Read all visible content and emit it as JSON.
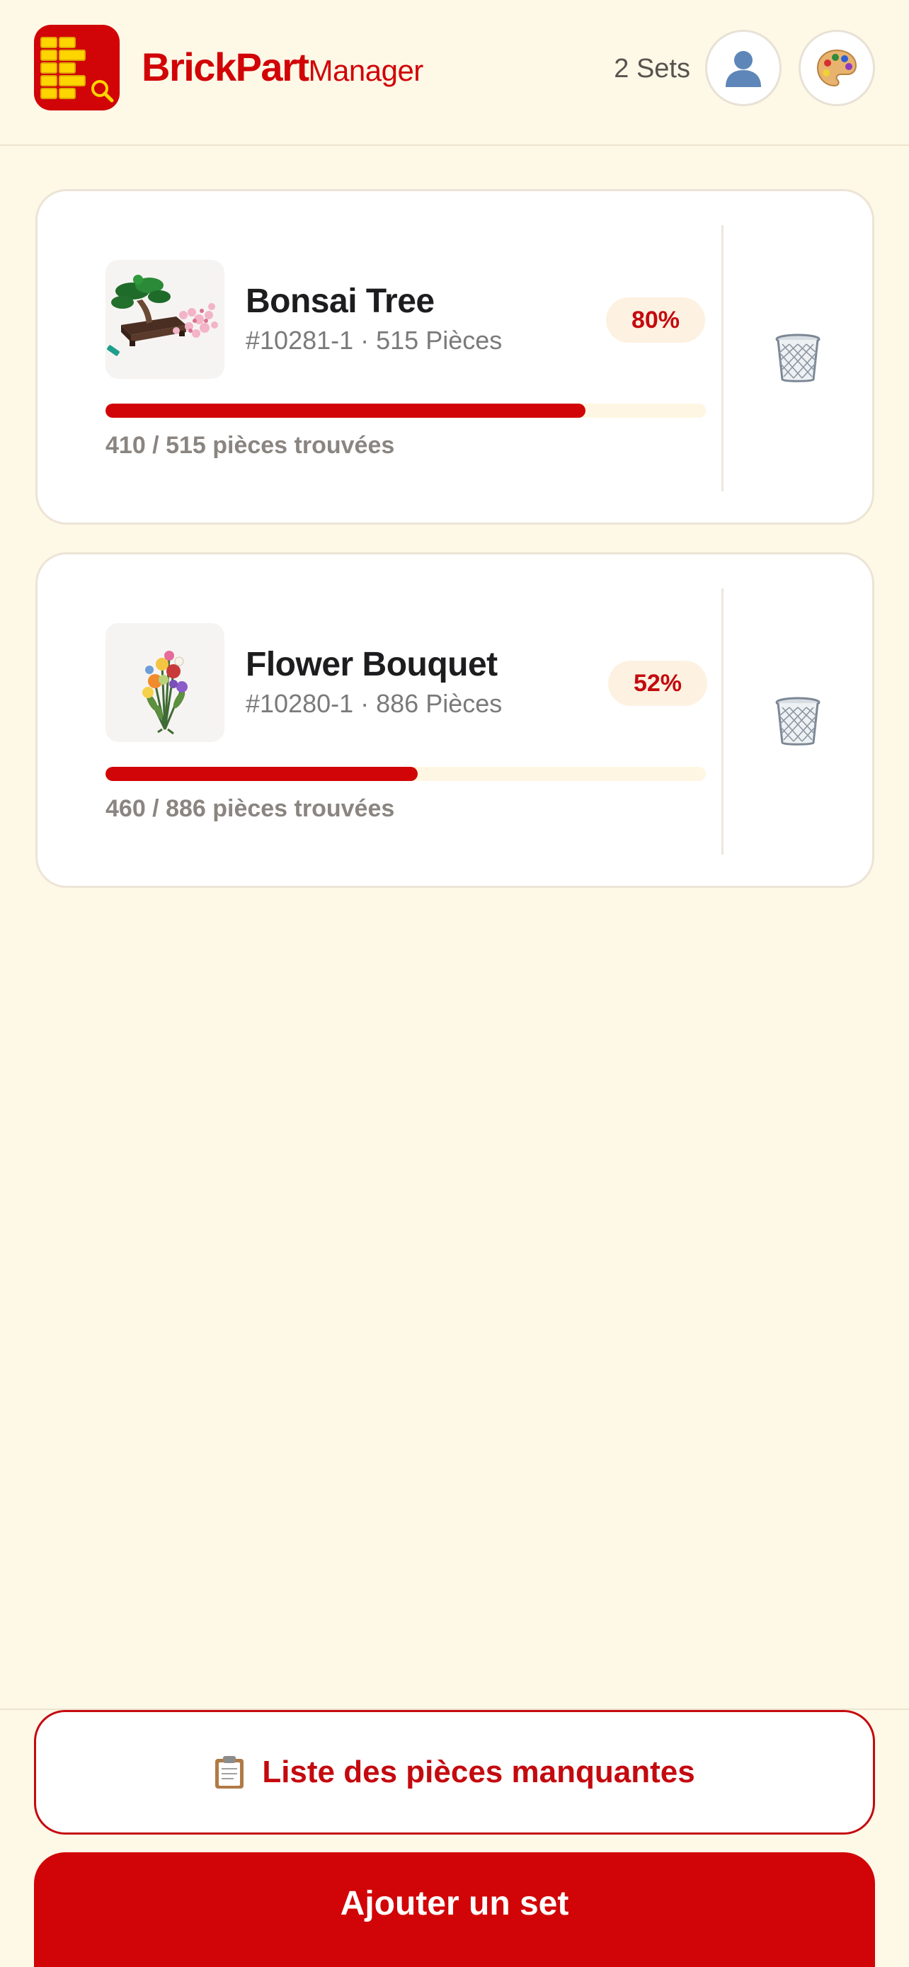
{
  "header": {
    "brand_main": "BrickPart",
    "brand_sub": "Manager",
    "sets_count": "2 Sets",
    "logo_icon": "brick-search-logo",
    "profile_icon": "user-silhouette-icon",
    "theme_icon": "palette-icon"
  },
  "sets": [
    {
      "name": "Bonsai Tree",
      "meta": "#10281-1 · 515 Pièces",
      "percent_label": "80%",
      "progress": 0.8,
      "found_text": "410 / 515 pièces trouvées",
      "thumbnail_icon": "bonsai-tree-image",
      "delete_icon": "trash-bin-icon"
    },
    {
      "name": "Flower Bouquet",
      "meta": "#10280-1 · 886 Pièces",
      "percent_label": "52%",
      "progress": 0.52,
      "found_text": "460 / 886 pièces trouvées",
      "thumbnail_icon": "flower-bouquet-image",
      "delete_icon": "trash-bin-icon"
    }
  ],
  "footer": {
    "missing_icon": "clipboard-icon",
    "missing_label": "Liste des pièces manquantes",
    "add_label": "Ajouter un set"
  },
  "colors": {
    "background": "#FEF8E7",
    "brand_red": "#D10407",
    "badge_bg": "#FDF1E1",
    "progress_track": "#FEF6E2"
  }
}
